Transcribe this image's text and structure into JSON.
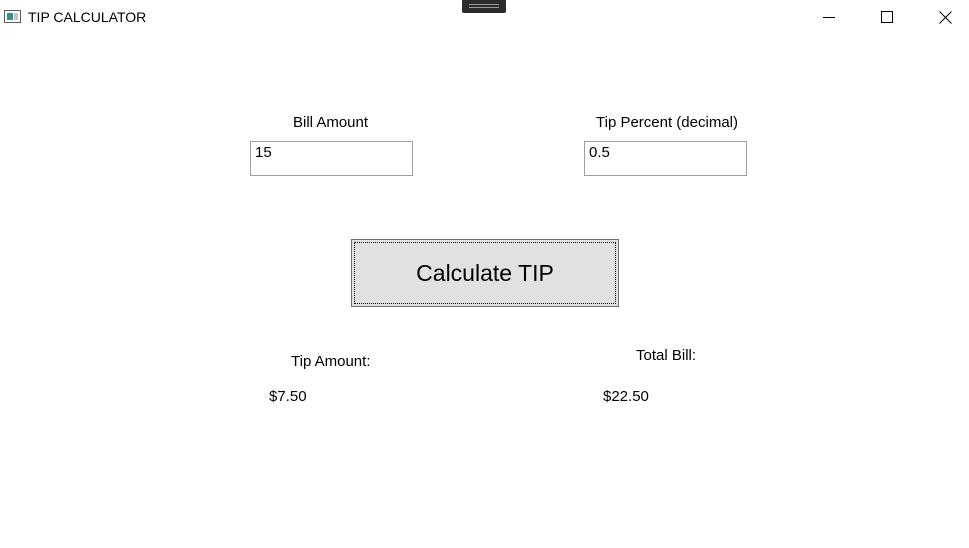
{
  "window": {
    "title": "TIP CALCULATOR"
  },
  "form": {
    "bill_amount_label": "Bill Amount",
    "bill_amount_value": "15",
    "tip_percent_label": "Tip Percent (decimal)",
    "tip_percent_value": "0.5",
    "calculate_button_label": "Calculate TIP",
    "tip_amount_label": "Tip Amount:",
    "tip_amount_value": "$7.50",
    "total_bill_label": "Total Bill:",
    "total_bill_value": "$22.50"
  },
  "icons": {
    "app": "app-window-icon",
    "minimize": "minimize-icon",
    "maximize": "maximize-icon",
    "close": "close-icon"
  },
  "colors": {
    "button_face": "#e1e1e1",
    "textbox_border": "#a0a0a0"
  }
}
